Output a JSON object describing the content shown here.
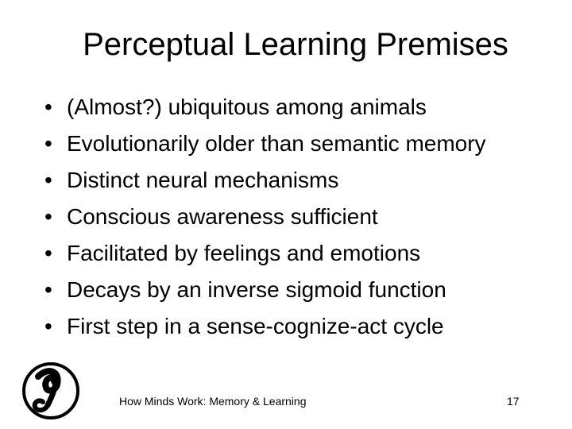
{
  "slide": {
    "title": "Perceptual Learning Premises",
    "bullet_symbol": "•",
    "bullets": [
      "(Almost?) ubiquitous among animals",
      "Evolutionarily older than semantic memory",
      "Distinct neural mechanisms",
      "Conscious awareness sufficient",
      "Facilitated by feelings and emotions",
      "Decays by an inverse sigmoid function",
      "First step in a sense-cognize-act cycle"
    ]
  },
  "footer": {
    "text": "How Minds Work: Memory & Learning",
    "page_number": "17"
  },
  "logo": {
    "icon": "circle-swirl-logo-icon"
  }
}
